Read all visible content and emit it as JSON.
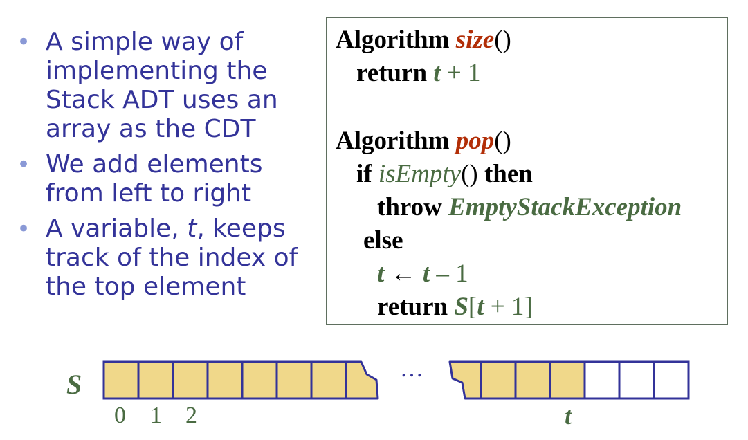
{
  "bullets": [
    {
      "lines": [
        "A simple way of",
        "implementing the",
        "Stack ADT uses an",
        "array as the CDT"
      ]
    },
    {
      "lines": [
        "We add elements",
        "from left to right"
      ]
    },
    {
      "before": "A variable, ",
      "var": "t",
      "after": ", keeps",
      "lines": [
        "track of the index of",
        "the top element"
      ]
    }
  ],
  "algorithm_size": {
    "keyword": "Algorithm",
    "name": "size",
    "parens": "()",
    "return_kw": "return",
    "t": "t",
    "plus_one": " + 1"
  },
  "algorithm_pop": {
    "keyword": "Algorithm",
    "name": "pop",
    "parens": "()",
    "if_kw": "if",
    "is_empty": "isEmpty",
    "is_empty_parens": "()",
    "then_kw": "then",
    "throw_kw": "throw",
    "exception": "EmptyStackException",
    "else_kw": "else",
    "t": "t",
    "arrow": " ← ",
    "minus_one": " – 1",
    "return_kw": "return",
    "array_name": "S",
    "open_bracket": "[",
    "close_bracket": "]"
  },
  "array": {
    "label": "S",
    "ellipsis": "…",
    "index_labels": [
      "0",
      "1",
      "2"
    ],
    "top_label": "t",
    "left_filled_cells": 8,
    "right_filled_cells": 4,
    "right_empty_cells": 3,
    "fill_color": "#f0d88a",
    "empty_color": "#ffffff",
    "border_color": "#333399"
  }
}
